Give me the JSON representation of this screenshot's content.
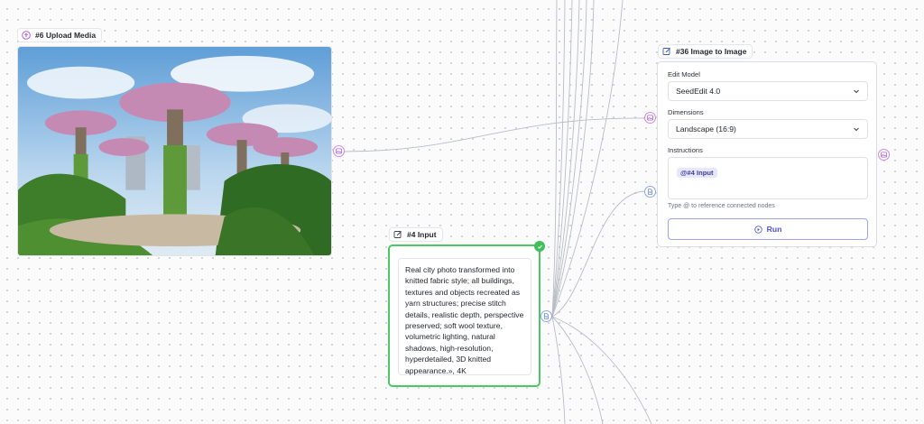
{
  "upload_node": {
    "title": "#6 Upload Media"
  },
  "input_node": {
    "title": "#4 Input",
    "text": "Real city photo transformed into knitted fabric style; all buildings, textures and objects recreated as yarn structures; precise stitch details, realistic depth, perspective preserved; soft wool texture, volumetric lighting, natural shadows, high-resolution, hyperdetailed, 3D knitted appearance.», 4K"
  },
  "i2i_node": {
    "title": "#36 Image to Image",
    "edit_model_label": "Edit Model",
    "edit_model_value": "SeedEdit 4.0",
    "dimensions_label": "Dimensions",
    "dimensions_value": "Landscape (16:9)",
    "instructions_label": "Instructions",
    "instructions_ref": "@#4 Input",
    "instructions_hint": "Type @ to reference connected nodes",
    "run_label": "Run"
  },
  "icons": {
    "upload": "upload-cloud-icon",
    "edit": "pencil-square-icon",
    "image_port": "image-icon",
    "text_port": "document-icon",
    "check": "check-icon",
    "chevron": "chevron-down-icon",
    "run": "play-circle-icon"
  },
  "colors": {
    "image_port": "#c58be6",
    "text_port": "#8aa6e6",
    "active_border": "#4cc765",
    "run_accent": "#4b4fc9",
    "wire": "#b8bcc4"
  }
}
